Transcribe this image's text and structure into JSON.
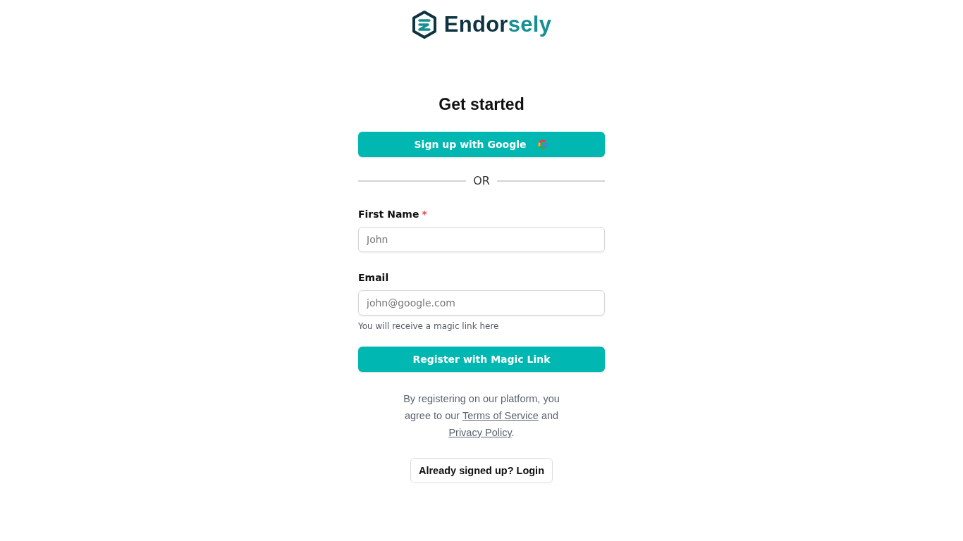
{
  "brand": {
    "name_parts": [
      {
        "text": "Endor",
        "color": "#0f3340"
      },
      {
        "text": "sely",
        "color": "#178f93"
      }
    ]
  },
  "heading": "Get started",
  "google_button": {
    "label": "Sign up with Google"
  },
  "divider": "OR",
  "fields": [
    {
      "label": "First Name",
      "required_mark": "*",
      "placeholder": "John"
    },
    {
      "label": "Email",
      "placeholder": "john@google.com",
      "hint": "You will receive a magic link here"
    }
  ],
  "submit_button": "Register with Magic Link",
  "terms": [
    {
      "kind": "text",
      "text": "By registering on our platform, you agree to our "
    },
    {
      "kind": "link",
      "text": "Terms of Service"
    },
    {
      "kind": "text",
      "text": " and "
    },
    {
      "kind": "link",
      "text": "Privacy Policy"
    },
    {
      "kind": "text",
      "text": "."
    }
  ],
  "login_button": "Already signed up? Login"
}
